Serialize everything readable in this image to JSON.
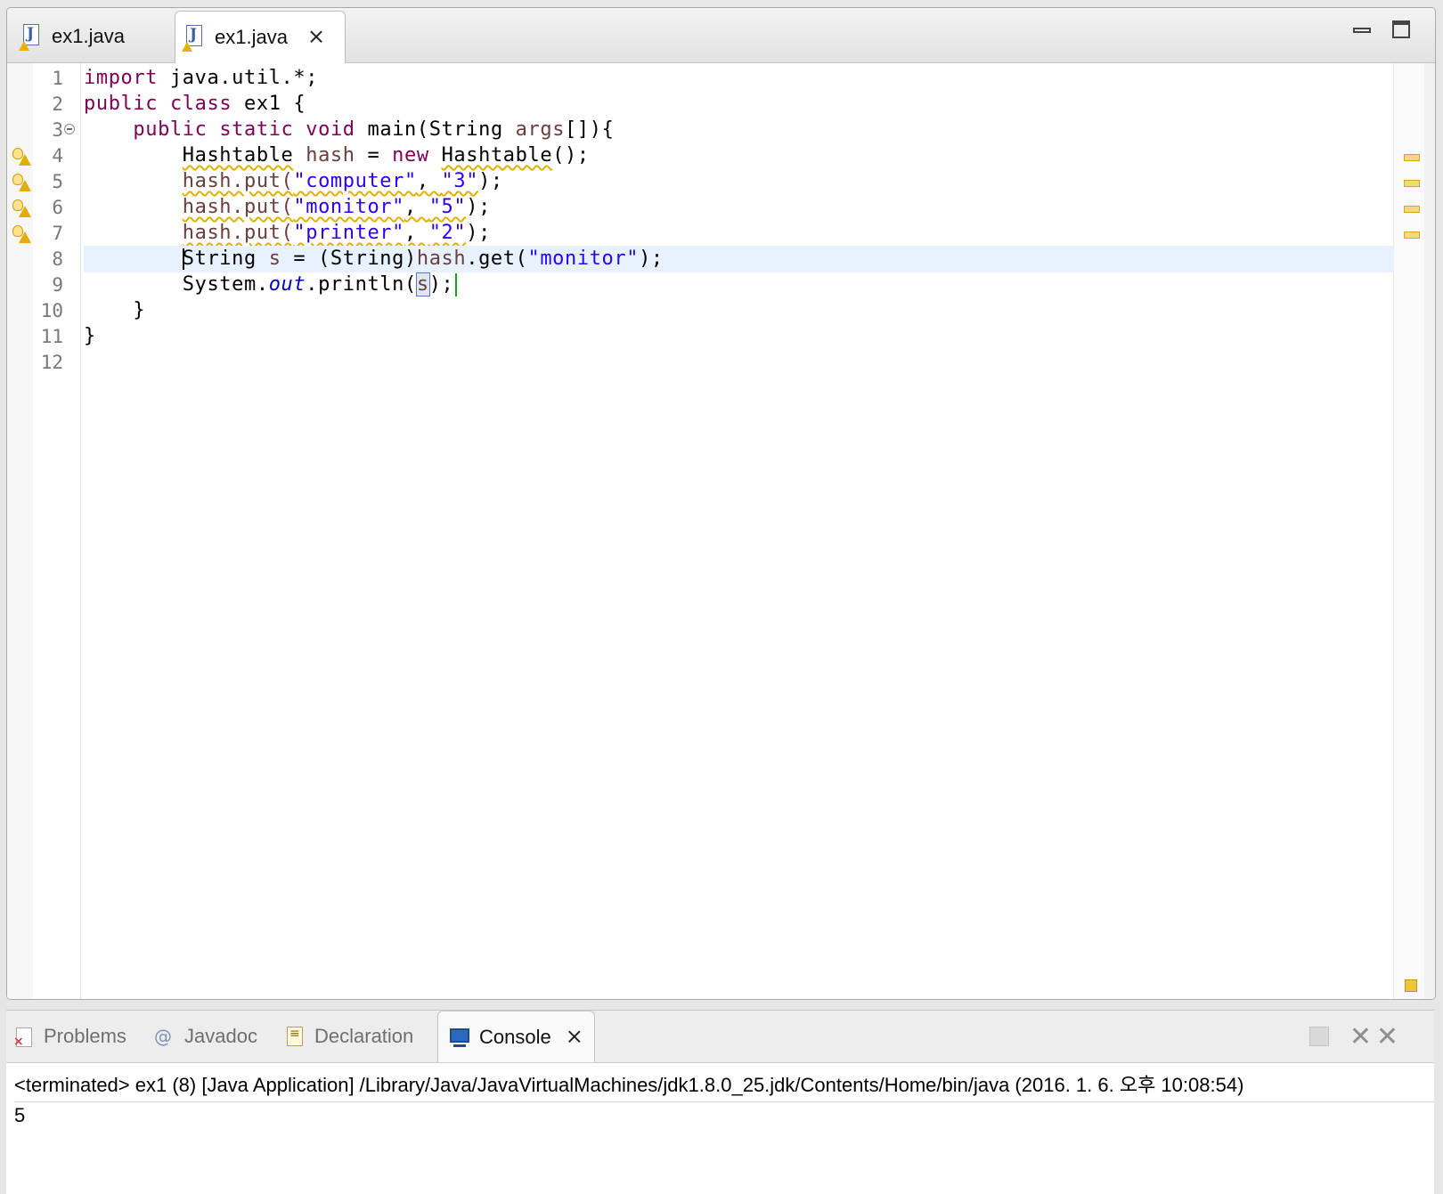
{
  "editor": {
    "tabs": [
      {
        "label": "ex1.java",
        "active": false
      },
      {
        "label": "ex1.java",
        "active": true,
        "close_icon": "close-icon"
      }
    ],
    "icons": {
      "file": "java-file-warning-icon",
      "minimize": "minimize-icon",
      "maximize": "maximize-icon"
    },
    "line_numbers": [
      "1",
      "2",
      "3",
      "4",
      "5",
      "6",
      "7",
      "8",
      "9",
      "10",
      "11",
      "12"
    ],
    "current_line": 8,
    "warning_lines": [
      4,
      5,
      6,
      7
    ],
    "code": {
      "l1_import": "import",
      "l1_rest": " java.util.*;",
      "l2_public": "public",
      "l2_class": "class",
      "l2_rest": " ex1 {",
      "l3_public": "public",
      "l3_static": "static",
      "l3_void": "void",
      "l3_main": " main(String ",
      "l3_args": "args",
      "l3_rest": "[]){",
      "l4_type": "Hashtable",
      "l4_var": "hash",
      "l4_eq": " = ",
      "l4_new": "new",
      "l4_ctor": "Hashtable",
      "l4_rest": "();",
      "l5_put": "hash.put(",
      "l5_k": "\"computer\"",
      "l5_sep": ", ",
      "l5_v": "\"3\"",
      "l5_end": ");",
      "l6_put": "hash.put(",
      "l6_k": "\"monitor\"",
      "l6_sep": ", ",
      "l6_v": "\"5\"",
      "l6_end": ");",
      "l7_put": "hash.put(",
      "l7_k": "\"printer\"",
      "l7_sep": ", ",
      "l7_v": "\"2\"",
      "l7_end": ");",
      "l8_string": "String ",
      "l8_s": "s",
      "l8_cast": " = (String)",
      "l8_hash": "hash",
      "l8_get": ".get(",
      "l8_key": "\"monitor\"",
      "l8_end": ");",
      "l9_system": "System.",
      "l9_out": "out",
      "l9_println": ".println(",
      "l9_s": "s",
      "l9_end": ");",
      "l10": "}",
      "l11": "}"
    }
  },
  "console": {
    "tabs": [
      {
        "label": "Problems",
        "icon": "problems-icon"
      },
      {
        "label": "Javadoc",
        "icon": "at-icon"
      },
      {
        "label": "Declaration",
        "icon": "declaration-icon"
      },
      {
        "label": "Console",
        "icon": "console-icon",
        "active": true
      }
    ],
    "header": "<terminated> ex1 (8) [Java Application] /Library/Java/JavaVirtualMachines/jdk1.8.0_25.jdk/Contents/Home/bin/java (2016. 1. 6. 오후 10:08:54)",
    "output": "5"
  },
  "colors": {
    "keyword": "#7f0055",
    "string": "#2a00ff",
    "field": "#0000c0",
    "local_variable": "#6a3e3e",
    "current_line": "#e8f2fe",
    "warning": "#e0b000"
  }
}
